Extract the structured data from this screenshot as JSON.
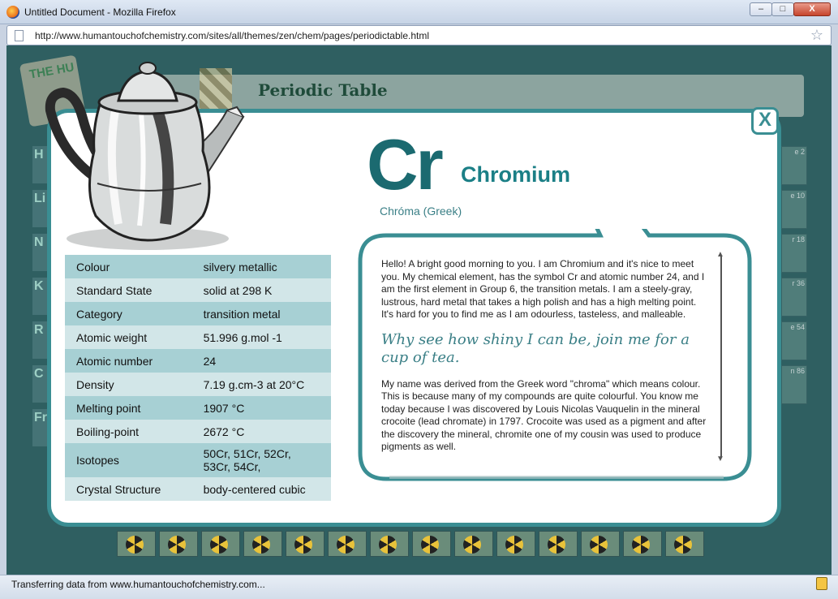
{
  "window": {
    "title": "Untitled Document - Mozilla Firefox",
    "min": "–",
    "max": "□",
    "close": "X"
  },
  "browser": {
    "url": "http://www.humantouchofchemistry.com/sites/all/themes/zen/chem/pages/periodictable.html",
    "star": "☆"
  },
  "page": {
    "header_title": "Periodic Table",
    "logo_text": "THE HU",
    "side_tiles": [
      "H",
      "Li",
      "N",
      "K",
      "R",
      "C",
      "Fr"
    ],
    "right_tiles": [
      "e 2",
      "e 10",
      "r 18",
      "r 36",
      "e 54",
      "n 86"
    ]
  },
  "element": {
    "symbol": "Cr",
    "name": "Chromium",
    "origin": "Chróma (Greek)",
    "close": "X",
    "properties": [
      {
        "label": "Colour",
        "value": "silvery metallic"
      },
      {
        "label": "Standard State",
        "value": "solid at 298 K"
      },
      {
        "label": "Category",
        "value": "transition metal"
      },
      {
        "label": "Atomic weight",
        "value": "51.996 g.mol -1"
      },
      {
        "label": "Atomic number",
        "value": "24"
      },
      {
        "label": "Density",
        "value": "7.19 g.cm-3 at 20°C"
      },
      {
        "label": "Melting point",
        "value": "1907 °C"
      },
      {
        "label": "Boiling-point",
        "value": "2672 °C"
      },
      {
        "label": "Isotopes",
        "value": "50Cr, 51Cr, 52Cr, 53Cr, 54Cr,"
      },
      {
        "label": "Crystal Structure",
        "value": "body-centered cubic"
      }
    ],
    "intro": "Hello! A bright good morning to you. I am Chromium and it's nice to meet you. My chemical element, has the symbol Cr and atomic number 24, and I am the first element in Group 6, the transition metals. I am a steely-gray, lustrous, hard metal that takes a high polish and has a high melting point. It's hard for you to find me as I am odourless, tasteless, and malleable.",
    "quote": "Why see how shiny I can be, join me for a cup of tea.",
    "history": "My name was derived from the Greek word \"chroma\" which means colour. This is because many of my compounds are quite colourful. You know me today because I was discovered by Louis Nicolas Vauquelin in the mineral crocoite (lead chromate) in 1797. Crocoite was used as a pigment and after the discovery the mineral, chromite  one of my cousin was used to produce pigments as well.",
    "scroll_up": "▲",
    "scroll_down": "▼"
  },
  "status": {
    "text": "Transferring data from www.humantouchofchemistry.com..."
  },
  "colors": {
    "accent": "#3a8e93",
    "page_bg": "#2f5f61",
    "row_dark": "#a7d0d4",
    "row_light": "#d2e6e8"
  }
}
